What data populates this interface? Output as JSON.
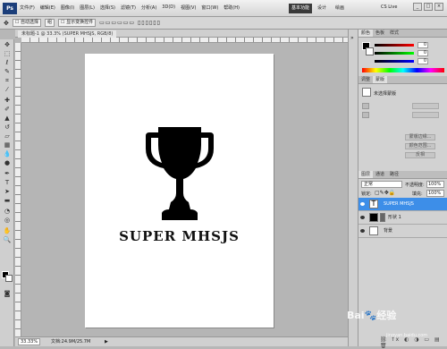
{
  "app": {
    "logo": "Ps",
    "zoom": "33.3",
    "workspace_active": "基本功能",
    "workspace_2": "设计",
    "workspace_3": "绘画",
    "cslive": "CS Live"
  },
  "menu": [
    "文件(F)",
    "编辑(E)",
    "图像(I)",
    "图层(L)",
    "选择(S)",
    "滤镜(T)",
    "分析(A)",
    "3D(D)",
    "视图(V)",
    "窗口(W)",
    "帮助(H)"
  ],
  "options": {
    "auto_select": "自动选择",
    "auto_select_value": "组",
    "show_transform": "显示变换控件"
  },
  "document": {
    "tab_title": "未标题-1 @ 33.3% (SUPER MHSJS, RGB/8)",
    "canvas_text": "SUPER MHSJS"
  },
  "status": {
    "zoom": "33.33%",
    "doc_size": "文档:24.9M/25.7M"
  },
  "panels": {
    "color_tabs": [
      "颜色",
      "色板",
      "样式"
    ],
    "color_values": [
      "0",
      "0",
      "0"
    ],
    "adj_tabs": [
      "调整",
      "蒙版"
    ],
    "mask_title": "未选择蒙版",
    "mask_buttons": [
      "蒙版边缘...",
      "颜色范围...",
      "反相"
    ],
    "layer_tabs": [
      "图层",
      "通道",
      "路径"
    ],
    "blend_mode": "正常",
    "opacity_label": "不透明度:",
    "opacity_value": "100%",
    "lock_label": "锁定:",
    "fill_label": "填充:",
    "fill_value": "100%",
    "layers": [
      {
        "name": "SUPER MHSJS",
        "type": "text"
      },
      {
        "name": "形状 1",
        "type": "shape"
      },
      {
        "name": "背景",
        "type": "background"
      }
    ]
  },
  "watermark": {
    "main": "Bai🐾经验",
    "sub": "jingyan.baidu.com"
  }
}
